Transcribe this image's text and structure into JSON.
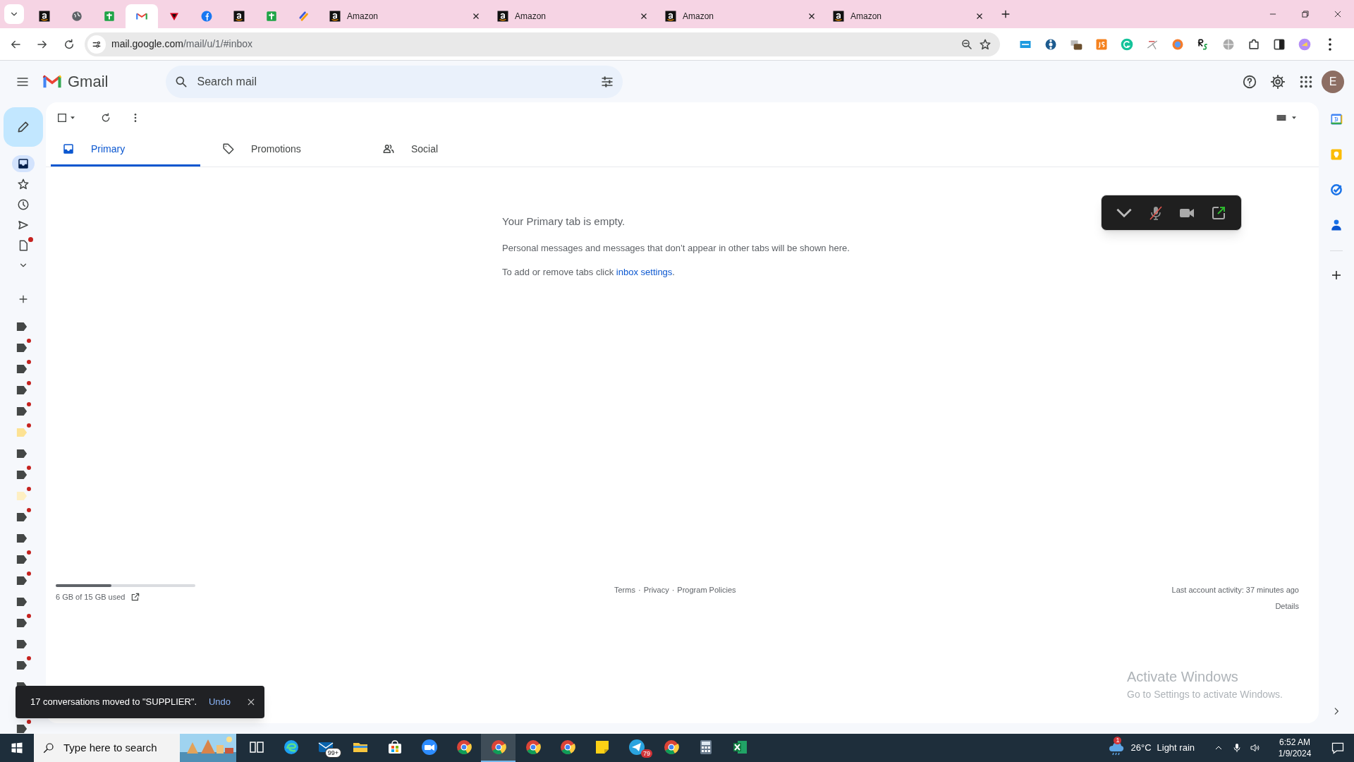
{
  "browser": {
    "tabs": [
      {
        "selected": false
      },
      {
        "selected": false
      },
      {
        "selected": false
      },
      {
        "selected": true
      },
      {
        "selected": false
      },
      {
        "selected": false
      },
      {
        "selected": false
      },
      {
        "selected": false
      },
      {
        "selected": false
      },
      {
        "label": "Amazon",
        "selected": false
      },
      {
        "label": "Amazon",
        "selected": false
      },
      {
        "label": "Amazon",
        "selected": false
      },
      {
        "label": "Amazon",
        "selected": false
      }
    ],
    "address": {
      "host": "mail.google.com",
      "path": "/mail/u/1/#inbox"
    }
  },
  "gmail": {
    "app_name": "Gmail",
    "search": {
      "placeholder": "Search mail"
    },
    "avatar": "E",
    "nav": [
      {
        "selected": true,
        "badge": false
      },
      {
        "selected": false,
        "badge": false
      },
      {
        "selected": false,
        "badge": false
      },
      {
        "selected": false,
        "badge": false
      },
      {
        "selected": false,
        "badge": true
      }
    ],
    "labels": [
      {
        "color": "#444746",
        "badge": false
      },
      {
        "color": "#444746",
        "badge": true
      },
      {
        "color": "#444746",
        "badge": true
      },
      {
        "color": "#444746",
        "badge": true
      },
      {
        "color": "#444746",
        "badge": true
      },
      {
        "color": "#fde293",
        "badge": true
      },
      {
        "color": "#444746",
        "badge": false
      },
      {
        "color": "#444746",
        "badge": true
      },
      {
        "color": "#feefc3",
        "badge": true
      },
      {
        "color": "#444746",
        "badge": true
      },
      {
        "color": "#444746",
        "badge": false
      },
      {
        "color": "#444746",
        "badge": true
      },
      {
        "color": "#444746",
        "badge": true
      },
      {
        "color": "#444746",
        "badge": false
      },
      {
        "color": "#444746",
        "badge": true
      },
      {
        "color": "#444746",
        "badge": false
      },
      {
        "color": "#444746",
        "badge": true
      },
      {
        "color": "#444746",
        "badge": false
      },
      {
        "color": "#444746",
        "badge": true
      }
    ],
    "footer_separator": "·",
    "inbox_tabs": [
      {
        "label": "Primary",
        "selected": true
      },
      {
        "label": "Promotions",
        "selected": false
      },
      {
        "label": "Social",
        "selected": false
      }
    ],
    "empty": {
      "title": "Your Primary tab is empty.",
      "message": "Personal messages and messages that don’t appear in other tabs will be shown here.",
      "hint": "To add or remove tabs click ",
      "link": "inbox settings",
      "hint_end": "."
    },
    "storage": {
      "level": 0.4,
      "text": "6 GB of 15 GB used"
    },
    "footer_links": [
      "Terms",
      "Privacy",
      "Program Policies"
    ],
    "activity": {
      "text": "Last account activity: 37 minutes ago",
      "details": "Details"
    },
    "toast": {
      "text": "17 conversations moved to \"SUPPLIER\".",
      "action": "Undo"
    }
  },
  "activation": {
    "title": "Activate Windows",
    "text": "Go to Settings to activate Windows."
  },
  "taskbar": {
    "search": {
      "placeholder": "Type here to search"
    },
    "apps": [
      {
        "selected": false
      },
      {
        "selected": false
      },
      {
        "selected": false,
        "badge": "99+"
      },
      {
        "selected": false
      },
      {
        "selected": false
      },
      {
        "selected": false
      },
      {
        "selected": false
      },
      {
        "selected": true
      },
      {
        "selected": false
      },
      {
        "selected": false
      },
      {
        "selected": false
      },
      {
        "selected": false,
        "badge": "79"
      },
      {
        "selected": false
      },
      {
        "selected": false
      },
      {
        "selected": false
      }
    ],
    "weather": {
      "alert": "1",
      "temperature": "26°C",
      "condition": "Light rain"
    },
    "time": "6:52 AM",
    "date": "1/9/2024"
  }
}
